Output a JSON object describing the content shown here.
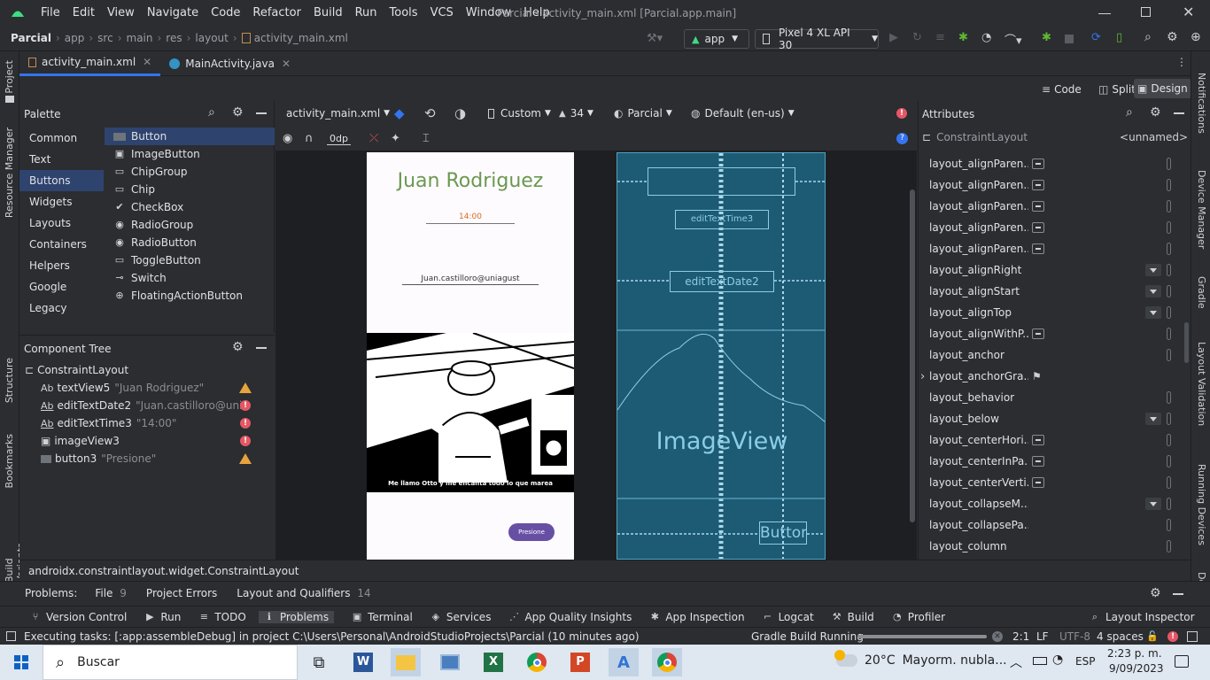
{
  "titlebar": {
    "menu": [
      "File",
      "Edit",
      "View",
      "Navigate",
      "Code",
      "Refactor",
      "Build",
      "Run",
      "Tools",
      "VCS",
      "Window",
      "Help"
    ],
    "window_title": "Parcial - activity_main.xml [Parcial.app.main]"
  },
  "navbar": {
    "breadcrumb": [
      "Parcial",
      "app",
      "src",
      "main",
      "res",
      "layout",
      "activity_main.xml"
    ],
    "run_config": "app",
    "device": "Pixel 4 XL API 30"
  },
  "tabs": [
    {
      "label": "activity_main.xml"
    },
    {
      "label": "MainActivity.java"
    }
  ],
  "modes": {
    "code": "Code",
    "split": "Split",
    "design": "Design"
  },
  "left_strip": {
    "project": "Project",
    "resource_manager": "Resource Manager",
    "structure": "Structure",
    "bookmarks": "Bookmarks",
    "build_variants": "Build Variants"
  },
  "right_strip": {
    "notifications": "Notifications",
    "device_manager": "Device Manager",
    "gradle": "Gradle",
    "layout_validation": "Layout Validation",
    "running_devices": "Running Devices",
    "device": "Devic"
  },
  "palette": {
    "title": "Palette",
    "categories": [
      "Common",
      "Text",
      "Buttons",
      "Widgets",
      "Layouts",
      "Containers",
      "Helpers",
      "Google",
      "Legacy"
    ],
    "items": [
      "Button",
      "ImageButton",
      "ChipGroup",
      "Chip",
      "CheckBox",
      "RadioGroup",
      "RadioButton",
      "ToggleButton",
      "Switch",
      "FloatingActionButton"
    ]
  },
  "component_tree": {
    "title": "Component Tree",
    "root": "ConstraintLayout",
    "nodes": [
      {
        "id": "textView5",
        "text": "\"Juan Rodriguez\"",
        "status": "warning"
      },
      {
        "id": "editTextDate2",
        "text": "\"Juan.castilloro@uniag...",
        "status": "error"
      },
      {
        "id": "editTextTime3",
        "text": "\"14:00\"",
        "status": "error"
      },
      {
        "id": "imageView3",
        "text": "",
        "status": "error"
      },
      {
        "id": "button3",
        "text": "\"Presione\"",
        "status": "warning"
      }
    ]
  },
  "design_toolbar": {
    "file": "activity_main.xml",
    "device": "Custom",
    "api": "34",
    "theme": "Parcial",
    "locale": "Default (en-us)",
    "margin": "0dp"
  },
  "preview": {
    "name": "Juan Rodriguez",
    "time": "14:00",
    "email": "Juan.castilloro@uniagust",
    "caption": "Me llamo Otto y me encanta todo lo que marea",
    "button": "Presione"
  },
  "blueprint": {
    "time_field": "editTextTime3",
    "date_field": "editTextDate2",
    "image": "ImageView",
    "button": "Button"
  },
  "attributes": {
    "title": "Attributes",
    "component": "ConstraintLayout",
    "id_value": "<unnamed>",
    "rows": [
      {
        "name": "layout_alignParen...",
        "control": "minus"
      },
      {
        "name": "layout_alignParen...",
        "control": "minus"
      },
      {
        "name": "layout_alignParen...",
        "control": "minus"
      },
      {
        "name": "layout_alignParen...",
        "control": "minus"
      },
      {
        "name": "layout_alignParen...",
        "control": "minus"
      },
      {
        "name": "layout_alignRight",
        "control": "dropdown"
      },
      {
        "name": "layout_alignStart",
        "control": "dropdown"
      },
      {
        "name": "layout_alignTop",
        "control": "dropdown"
      },
      {
        "name": "layout_alignWithP...",
        "control": "minus"
      },
      {
        "name": "layout_anchor",
        "control": "none"
      },
      {
        "name": "layout_anchorGra...",
        "control": "flag"
      },
      {
        "name": "layout_behavior",
        "control": "none"
      },
      {
        "name": "layout_below",
        "control": "dropdown"
      },
      {
        "name": "layout_centerHori...",
        "control": "minus"
      },
      {
        "name": "layout_centerInPa...",
        "control": "minus"
      },
      {
        "name": "layout_centerVerti...",
        "control": "minus"
      },
      {
        "name": "layout_collapseM...",
        "control": "dropdown"
      },
      {
        "name": "layout_collapsePa...",
        "control": "none"
      },
      {
        "name": "layout_column",
        "control": "none"
      }
    ]
  },
  "class_bar": "androidx.constraintlayout.widget.ConstraintLayout",
  "problems_bar": {
    "label": "Problems:",
    "tabs": [
      {
        "label": "File",
        "count": "9"
      },
      {
        "label": "Project Errors",
        "count": ""
      },
      {
        "label": "Layout and Qualifiers",
        "count": "14"
      }
    ]
  },
  "tool_windows": [
    "Version Control",
    "Run",
    "TODO",
    "Problems",
    "Terminal",
    "Services",
    "App Quality Insights",
    "App Inspection",
    "Logcat",
    "Build",
    "Profiler"
  ],
  "layout_inspector": "Layout Inspector",
  "status": {
    "message": "Executing tasks: [:app:assembleDebug] in project C:\\Users\\Personal\\AndroidStudioProjects\\Parcial (10 minutes ago)",
    "gradle": "Gradle Build Running",
    "position": "2:1",
    "line_sep": "LF",
    "encoding": "UTF-8",
    "indent": "4 spaces"
  },
  "taskbar": {
    "search": "Buscar",
    "weather_temp": "20°C",
    "weather_desc": "Mayorm. nubla...",
    "lang": "ESP",
    "time": "2:23 p. m.",
    "date": "9/09/2023"
  }
}
